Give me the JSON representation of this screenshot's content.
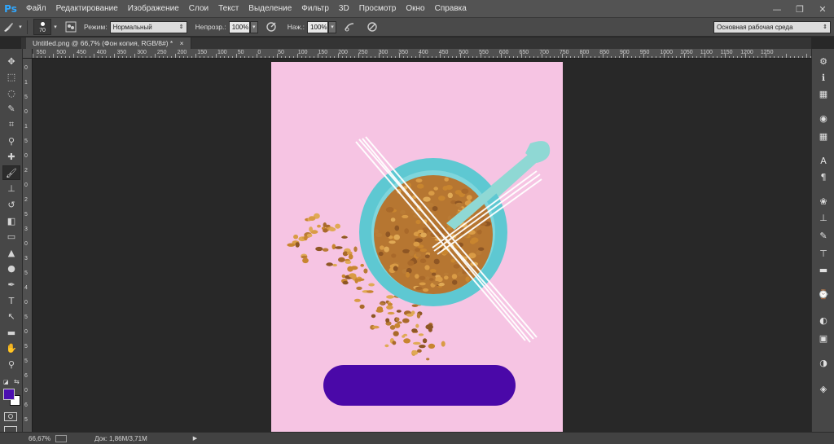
{
  "app": {
    "logo": "Ps",
    "menu": [
      "Файл",
      "Редактирование",
      "Изображение",
      "Слои",
      "Текст",
      "Выделение",
      "Фильтр",
      "3D",
      "Просмотр",
      "Окно",
      "Справка"
    ],
    "window_controls": [
      "—",
      "❐",
      "✕"
    ]
  },
  "options": {
    "brush_size": "70",
    "mode_label": "Режим:",
    "mode_value": "Нормальный",
    "opacity_label": "Непрозр.:",
    "opacity_value": "100%",
    "flow_label": "Наж.:",
    "flow_value": "100%",
    "workspace": "Основная рабочая среда"
  },
  "document": {
    "tab_title": "Untitled.png @ 66,7% (Фон копия, RGB/8#) *",
    "tab_close": "×"
  },
  "ruler_top": [
    "0",
    "550",
    "500",
    "450",
    "400",
    "350",
    "300",
    "250",
    "200",
    "150",
    "100",
    "50",
    "0",
    "50",
    "100",
    "150",
    "200",
    "250",
    "300",
    "350",
    "400",
    "450",
    "500",
    "550",
    "600",
    "650",
    "700",
    "750",
    "800",
    "850",
    "900",
    "950",
    "1000",
    "1050",
    "1100",
    "1150",
    "1200",
    "1250"
  ],
  "ruler_left": [
    "0",
    "1",
    "5",
    "0",
    "1",
    "5",
    "0",
    "2",
    "0",
    "2",
    "5",
    "3",
    "0",
    "3",
    "5",
    "4",
    "0",
    "5",
    "0",
    "5",
    "5",
    "6",
    "0",
    "6",
    "5"
  ],
  "left_tools": [
    {
      "name": "move-tool-icon",
      "glyph": "✥"
    },
    {
      "name": "marquee-tool-icon",
      "glyph": "⬚"
    },
    {
      "name": "lasso-tool-icon",
      "glyph": "◌"
    },
    {
      "name": "quick-select-tool-icon",
      "glyph": "✎"
    },
    {
      "name": "crop-tool-icon",
      "glyph": "⌗"
    },
    {
      "name": "eyedropper-tool-icon",
      "glyph": "⚲"
    },
    {
      "name": "healing-brush-tool-icon",
      "glyph": "✚"
    },
    {
      "name": "brush-tool-icon",
      "glyph": "🖌"
    },
    {
      "name": "clone-stamp-tool-icon",
      "glyph": "⊥"
    },
    {
      "name": "history-brush-tool-icon",
      "glyph": "↺"
    },
    {
      "name": "eraser-tool-icon",
      "glyph": "◧"
    },
    {
      "name": "gradient-tool-icon",
      "glyph": "▭"
    },
    {
      "name": "blur-tool-icon",
      "glyph": "▲"
    },
    {
      "name": "dodge-tool-icon",
      "glyph": "●"
    },
    {
      "name": "pen-tool-icon",
      "glyph": "✒"
    },
    {
      "name": "type-tool-icon",
      "glyph": "T"
    },
    {
      "name": "path-select-tool-icon",
      "glyph": "↖"
    },
    {
      "name": "rectangle-tool-icon",
      "glyph": "▬"
    },
    {
      "name": "hand-tool-icon",
      "glyph": "✋"
    },
    {
      "name": "zoom-tool-icon",
      "glyph": "⚲"
    }
  ],
  "colors": {
    "foreground": "#4b0fb0",
    "background": "#ffffff",
    "canvas_bg": "#f6c4e3",
    "bowl": "#5ec8d2",
    "pill": "#4a08a8"
  },
  "right_tools": [
    {
      "name": "arrange-panels-icon",
      "glyph": "⚙"
    },
    {
      "name": "info-panel-icon",
      "glyph": "ℹ"
    },
    {
      "name": "histogram-panel-icon",
      "glyph": "▦"
    },
    {
      "name": "color-panel-icon",
      "glyph": "◉"
    },
    {
      "name": "swatches-panel-icon",
      "glyph": "▦"
    },
    {
      "name": "character-panel-icon",
      "glyph": "A"
    },
    {
      "name": "paragraph-panel-icon",
      "glyph": "¶"
    },
    {
      "name": "brush-panel-icon",
      "glyph": "❀"
    },
    {
      "name": "clone-source-panel-icon",
      "glyph": "⊥"
    },
    {
      "name": "brush-presets-icon",
      "glyph": "✎"
    },
    {
      "name": "tool-presets-icon",
      "glyph": "⊤"
    },
    {
      "name": "actions-panel-icon",
      "glyph": "▬"
    },
    {
      "name": "history-panel-icon",
      "glyph": "⌚"
    },
    {
      "name": "adjustments-panel-icon",
      "glyph": "◐"
    },
    {
      "name": "styles-panel-icon",
      "glyph": "▣"
    },
    {
      "name": "masks-panel-icon",
      "glyph": "◑"
    },
    {
      "name": "layers-panel-icon",
      "glyph": "◈"
    }
  ],
  "status": {
    "zoom": "66,67%",
    "doc_info": "Док: 1,86M/3,71M",
    "arrow": "▶"
  }
}
